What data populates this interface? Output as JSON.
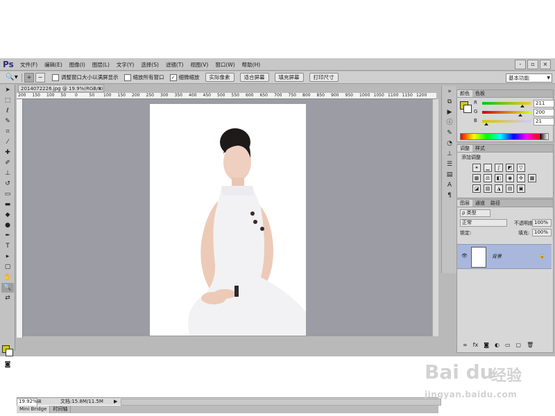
{
  "app": {
    "logo": "Ps"
  },
  "menu": [
    "文件(F)",
    "编辑(E)",
    "图像(I)",
    "图层(L)",
    "文字(Y)",
    "选择(S)",
    "滤镜(T)",
    "视图(V)",
    "窗口(W)",
    "帮助(H)"
  ],
  "window_controls": [
    "-",
    "▫",
    "×"
  ],
  "options": {
    "resize_windows": "调整窗口大小以满屏显示",
    "zoom_all_windows": "缩放所有窗口",
    "scrubby_zoom": "细微缩放",
    "actual_pixels": "实际像素",
    "fit_screen": "适合屏幕",
    "fill_screen": "填充屏幕",
    "print_size": "打印尺寸",
    "workspace": "基本功能"
  },
  "document": {
    "tab_title": "2014072226.jpg @ 19.9%(RGB/8)",
    "ruler_ticks": [
      "200",
      "150",
      "100",
      "50",
      "0",
      "50",
      "100",
      "150",
      "200",
      "250",
      "300",
      "350",
      "400",
      "450",
      "500",
      "550",
      "600",
      "650",
      "700",
      "750",
      "800",
      "850",
      "900",
      "950",
      "1000",
      "1050",
      "1100",
      "1150",
      "1200"
    ],
    "zoom": "19.92%",
    "doc_size": "文档:15.8M/11.5M"
  },
  "bottom_tabs": [
    "Mini Bridge",
    "时间轴"
  ],
  "color_panel": {
    "tabs": [
      "颜色",
      "色板"
    ],
    "r_label": "R",
    "g_label": "G",
    "b_label": "B",
    "r": "211",
    "g": "200",
    "b": "21",
    "foreground": "#d3c815",
    "r_fraction": 0.83,
    "g_fraction": 0.78,
    "b_fraction": 0.08
  },
  "adjustments_panel": {
    "tabs": [
      "调整",
      "样式"
    ],
    "title": "添加调整"
  },
  "layers_panel": {
    "tabs": [
      "图层",
      "通道",
      "路径"
    ],
    "filter": "类型",
    "blend_mode": "正常",
    "opacity_label": "不透明度:",
    "opacity": "100%",
    "lock_label": "锁定:",
    "fill_label": "填充:",
    "fill": "100%",
    "layer_name": "背景"
  },
  "watermark": {
    "logo": "Bai du",
    "cn": "经验",
    "url": "jingyan.baidu.com"
  }
}
